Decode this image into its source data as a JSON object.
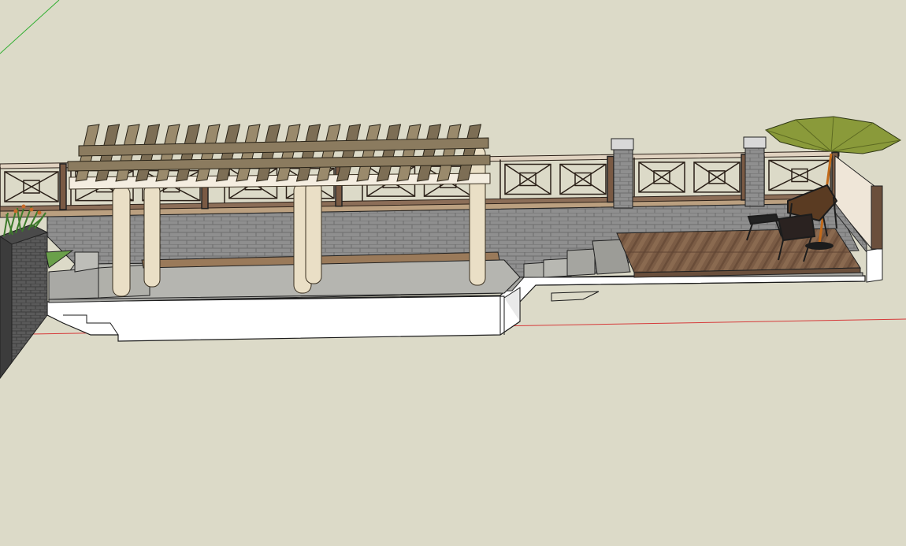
{
  "window": {
    "title": ""
  },
  "viewport": {
    "background": "#dcdac8",
    "axis_colors": {
      "red": "#d63a3a",
      "green": "#2fae2f"
    }
  },
  "model": {
    "components": [
      "pergola",
      "pergola-beams",
      "pergola-columns",
      "bench",
      "railing",
      "brick-wall",
      "stairs",
      "wood-deck",
      "patio-umbrella",
      "lounge-chair",
      "folding-chair",
      "planter"
    ],
    "colors": {
      "brick": "#8a8a8a",
      "deck": "#7a5a44",
      "beam": "#8b7b5f",
      "column": "#eadfc6",
      "umbrella": "#8a9a3a",
      "slab": "#ffffff"
    }
  }
}
